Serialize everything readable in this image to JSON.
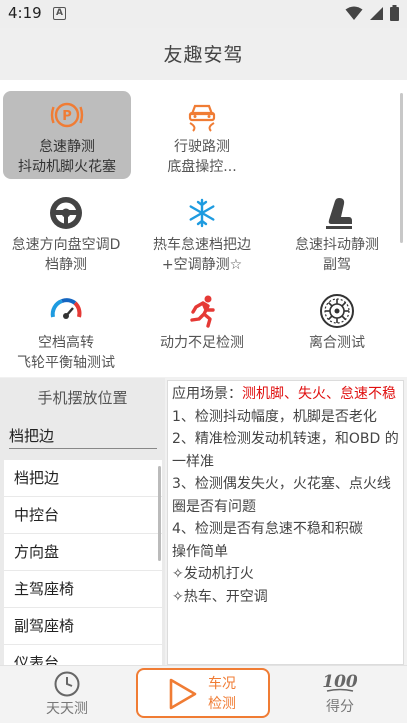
{
  "status": {
    "time": "4:19",
    "notif": "A"
  },
  "header": {
    "title": "友趣安驾"
  },
  "modes": [
    {
      "line1": "怠速静测",
      "line2": "抖动机脚火花塞",
      "icon": "parking-brake-icon",
      "selected": true
    },
    {
      "line1": "行驶路测",
      "line2": "底盘操控...",
      "icon": "car-road-icon",
      "selected": false
    },
    {
      "line1": "怠速方向盘空调D",
      "line2": "档静测",
      "icon": "steering-wheel-icon",
      "selected": false
    },
    {
      "line1": "热车怠速档把边",
      "line2": "+空调静测☆",
      "icon": "snowflake-icon",
      "selected": false
    },
    {
      "line1": "怠速抖动静测",
      "line2": "副驾",
      "icon": "car-seat-icon",
      "selected": false
    },
    {
      "line1": "空档高转",
      "line2": "飞轮平衡轴测试",
      "icon": "speedometer-icon",
      "selected": false
    },
    {
      "line1": "动力不足检测",
      "line2": "",
      "icon": "running-man-icon",
      "selected": false
    },
    {
      "line1": "离合测试",
      "line2": "",
      "icon": "clutch-disc-icon",
      "selected": false
    }
  ],
  "phone_position": {
    "title": "手机摆放位置",
    "current": "档把边",
    "options": [
      "档把边",
      "中控台",
      "方向盘",
      "主驾座椅",
      "副驾座椅",
      "仪表台"
    ]
  },
  "description": {
    "scene_label": "应用场景：",
    "scene_value": "测机脚、失火、怠速不稳",
    "lines": [
      "1、检测抖动幅度，机脚是否老化",
      "2、精准检测发动机转速，和OBD 的一样准",
      "3、检测偶发失火，火花塞、点火线圈是否有问题",
      "4、检测是否有怠速不稳和积碳",
      "操作简单",
      "✧发动机打火",
      "✧热车、开空调"
    ]
  },
  "bottom_nav": {
    "daily": "天天测",
    "center_line1": "车况",
    "center_line2": "检测",
    "score": "得分"
  },
  "colors": {
    "accent": "#f07c34",
    "highlight_red": "#e01010",
    "selected_bg": "#bdbdbd",
    "icon_blue": "#1e9be0"
  }
}
